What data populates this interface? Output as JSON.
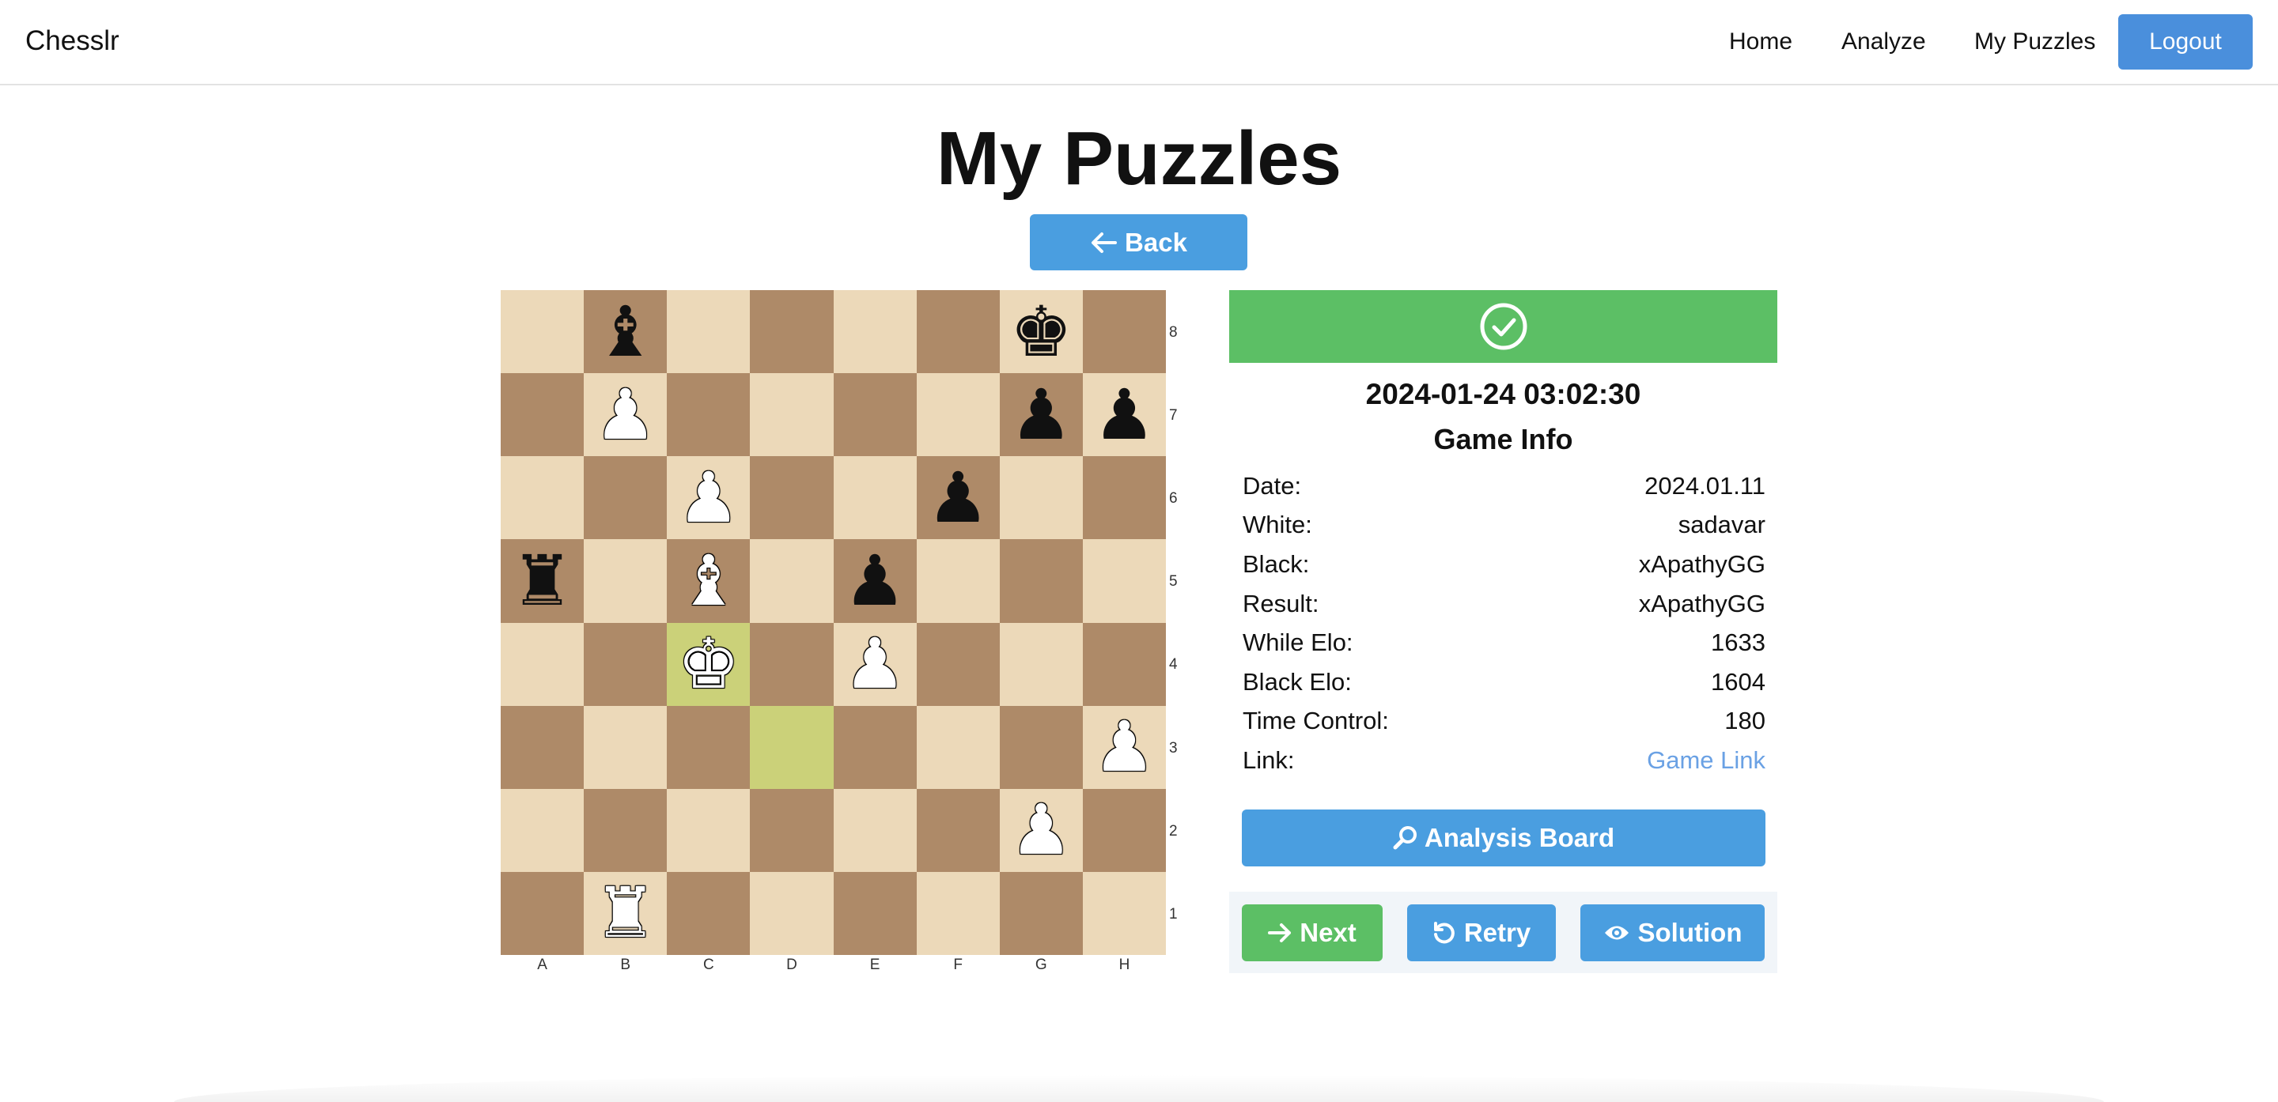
{
  "app": {
    "brand": "Chesslr"
  },
  "nav": {
    "home": "Home",
    "analyze": "Analyze",
    "my_puzzles": "My Puzzles",
    "logout": "Logout"
  },
  "page": {
    "title": "My Puzzles",
    "back_label": "Back",
    "back_icon": "arrow-left-icon"
  },
  "status": {
    "state": "solved",
    "icon": "check-circle-icon",
    "color": "#5cbf65"
  },
  "puzzle": {
    "datetime": "2024-01-24 03:02:30"
  },
  "game_info": {
    "heading": "Game Info",
    "rows": [
      {
        "label": "Date:",
        "value": "2024.01.11"
      },
      {
        "label": "White:",
        "value": "sadavar"
      },
      {
        "label": "Black:",
        "value": "xApathyGG"
      },
      {
        "label": "Result:",
        "value": "xApathyGG"
      },
      {
        "label": "While Elo:",
        "value": "1633"
      },
      {
        "label": "Black Elo:",
        "value": "1604"
      },
      {
        "label": "Time Control:",
        "value": "180"
      },
      {
        "label": "Link:",
        "value": "Game Link"
      }
    ]
  },
  "buttons": {
    "analysis": "Analysis Board",
    "next": "Next",
    "retry": "Retry",
    "solution": "Solution"
  },
  "board": {
    "files": [
      "A",
      "B",
      "C",
      "D",
      "E",
      "F",
      "G",
      "H"
    ],
    "ranks": [
      "8",
      "7",
      "6",
      "5",
      "4",
      "3",
      "2",
      "1"
    ],
    "highlighted": [
      "c4",
      "d3"
    ],
    "pieces": [
      {
        "square": "b8",
        "piece": "bishop",
        "color": "black"
      },
      {
        "square": "g8",
        "piece": "king",
        "color": "black"
      },
      {
        "square": "b7",
        "piece": "pawn",
        "color": "white"
      },
      {
        "square": "g7",
        "piece": "pawn",
        "color": "black"
      },
      {
        "square": "h7",
        "piece": "pawn",
        "color": "black"
      },
      {
        "square": "c6",
        "piece": "pawn",
        "color": "white"
      },
      {
        "square": "f6",
        "piece": "pawn",
        "color": "black"
      },
      {
        "square": "a5",
        "piece": "rook",
        "color": "black"
      },
      {
        "square": "c5",
        "piece": "bishop",
        "color": "white"
      },
      {
        "square": "e5",
        "piece": "pawn",
        "color": "black"
      },
      {
        "square": "c4",
        "piece": "king",
        "color": "white"
      },
      {
        "square": "e4",
        "piece": "pawn",
        "color": "white"
      },
      {
        "square": "h3",
        "piece": "pawn",
        "color": "white"
      },
      {
        "square": "g2",
        "piece": "pawn",
        "color": "white"
      },
      {
        "square": "b1",
        "piece": "rook",
        "color": "white"
      }
    ]
  },
  "colors": {
    "light_square": "#ecd9b9",
    "dark_square": "#ae8a68",
    "highlight": "#cbd179",
    "primary": "#4a9ee0",
    "success": "#5cbf65"
  }
}
